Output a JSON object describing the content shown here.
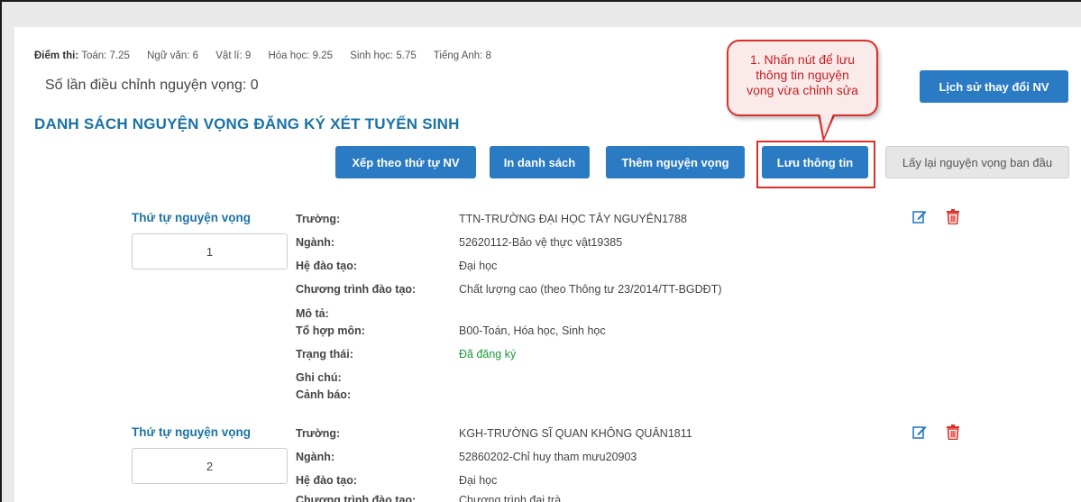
{
  "scores": {
    "label": "Điểm thi:",
    "items": [
      "Toán: 7.25",
      "Ngữ văn: 6",
      "Vật lí: 9",
      "Hóa học: 9.25",
      "Sinh học: 5.75",
      "Tiếng Anh: 8"
    ]
  },
  "adjust_count": "Số lần điều chỉnh nguyện vọng: 0",
  "heading": "DANH SÁCH NGUYỆN VỌNG ĐĂNG KÝ XÉT TUYỂN SINH",
  "buttons": {
    "history": "Lịch sử thay đổi NV",
    "sort": "Xếp theo thứ tự NV",
    "print": "In danh sách",
    "add": "Thêm nguyện vọng",
    "save": "Lưu thông tin",
    "restore": "Lấy lại nguyện vọng ban đầu"
  },
  "callout": {
    "line1": "1. Nhấn nút để lưu",
    "line2": "thông tin nguyện",
    "line3": "vọng vừa chỉnh sửa"
  },
  "field_labels": {
    "order": "Thứ tự nguyện vọng",
    "school": "Trường:",
    "major": "Ngành:",
    "training_type": "Hệ đào tạo:",
    "program": "Chương trình đào tạo:",
    "description": "Mô tả:",
    "subject_combo": "Tổ hợp môn:",
    "status": "Trạng thái:",
    "note": "Ghi chú:",
    "warning": "Cảnh báo:"
  },
  "entries": [
    {
      "order": "1",
      "school": "TTN-TRƯỜNG ĐẠI HỌC TÂY NGUYÊN1788",
      "major": "52620112-Bảo vệ thực vật19385",
      "training_type": "Đại học",
      "program": "Chất lượng cao (theo Thông tư 23/2014/TT-BGDĐT)",
      "subject_combo": "B00-Toán, Hóa học, Sinh học",
      "status": "Đã đăng ký"
    },
    {
      "order": "2",
      "school": "KGH-TRƯỜNG SĨ QUAN KHÔNG QUÂN1811",
      "major": "52860202-Chỉ huy tham mưu20903",
      "training_type": "Đại học",
      "program": "Chương trình đại trà"
    }
  ],
  "colors": {
    "primary_button": "#2a7ac4",
    "heading": "#1a73a8",
    "status_registered": "#1a9a3a",
    "callout_border": "#d9302a",
    "delete_icon": "#d9302a"
  }
}
